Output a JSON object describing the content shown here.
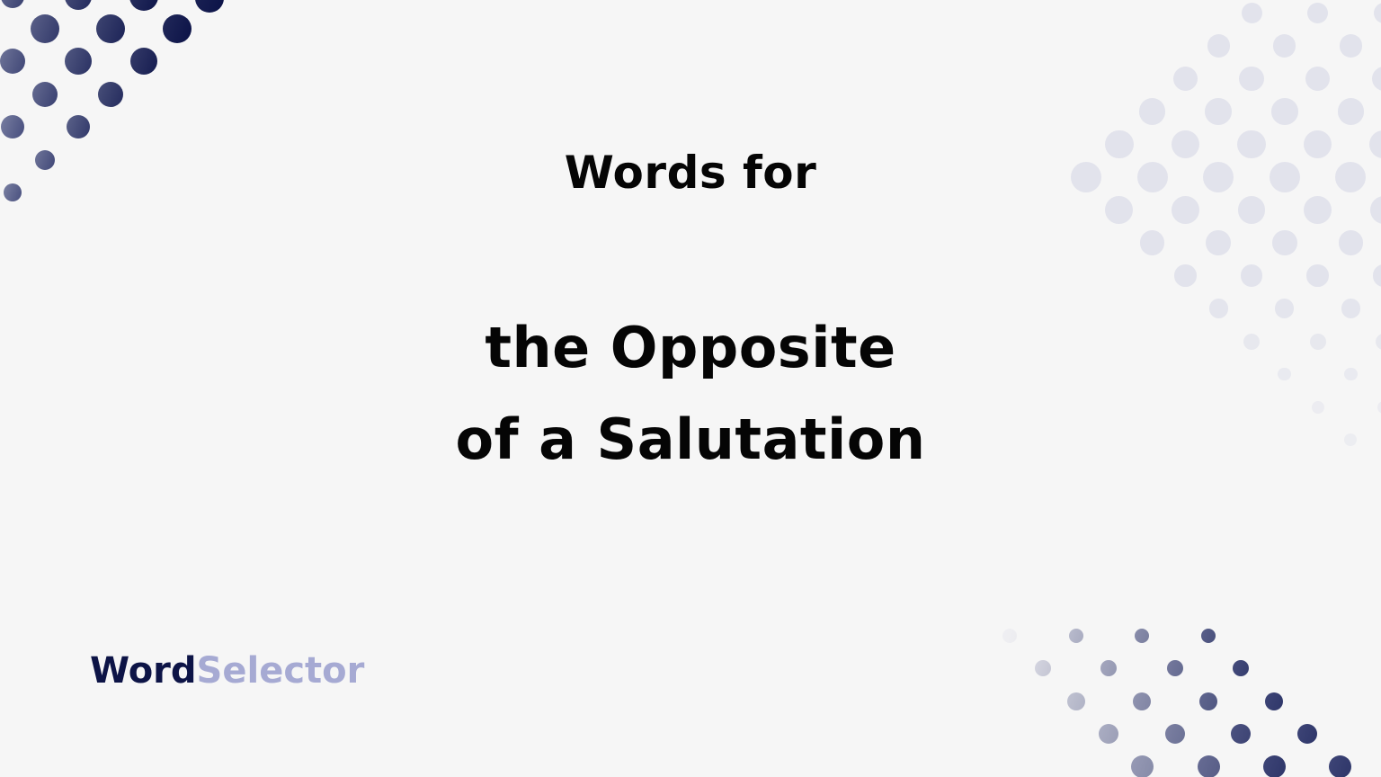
{
  "graphic": {
    "kicker": "Words for",
    "headline_lines": [
      "the Opposite",
      "of a Salutation"
    ]
  },
  "brand": {
    "part_a": "Word",
    "part_b": "Selector"
  },
  "colors": {
    "background": "#f6f6f6",
    "text": "#050505",
    "brand_dark": "#0d1446",
    "brand_light": "#a6aad3",
    "dots_dark": "#0b1247",
    "dots_mid": "#6a7196",
    "dots_light": "#e2e3ec"
  },
  "decorations": {
    "top_left_dots": "navy-gradient-dot-pattern",
    "top_right_dots": "light-lavender-dot-pattern",
    "bottom_right_dots": "gray-to-navy-dot-pattern"
  }
}
